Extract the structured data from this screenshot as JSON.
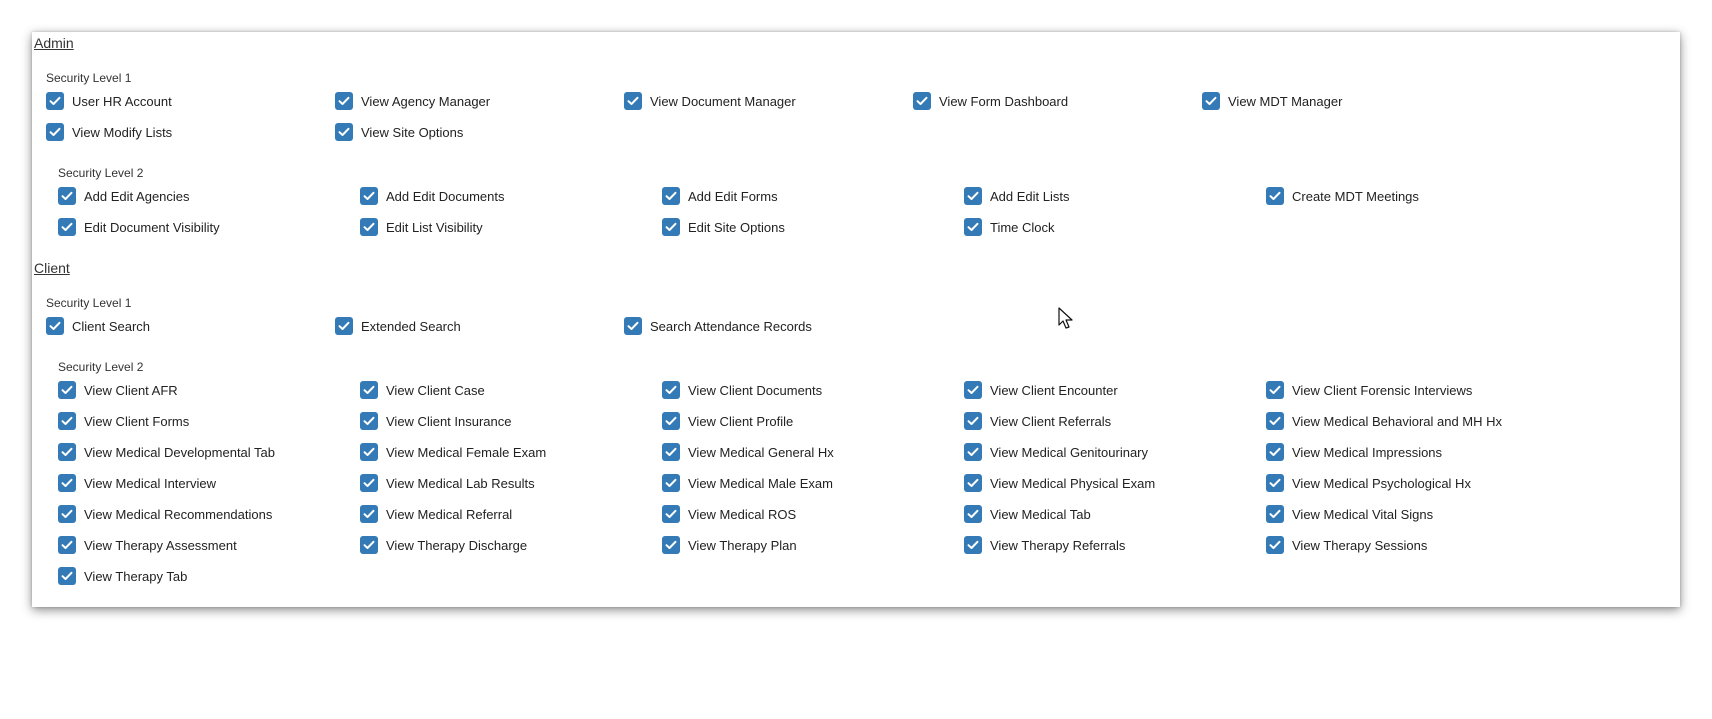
{
  "sections": [
    {
      "title": "Admin",
      "levels": [
        {
          "label": "Security Level 1",
          "items": [
            "User HR Account",
            "View Agency Manager",
            "View Document Manager",
            "View Form Dashboard",
            "View MDT Manager",
            "View Modify Lists",
            "View Site Options"
          ]
        },
        {
          "label": "Security Level 2",
          "items": [
            "Add Edit Agencies",
            "Add Edit Documents",
            "Add Edit Forms",
            "Add Edit Lists",
            "Create MDT Meetings",
            "Edit Document Visibility",
            "Edit List Visibility",
            "Edit Site Options",
            "Time Clock"
          ]
        }
      ]
    },
    {
      "title": "Client",
      "levels": [
        {
          "label": "Security Level 1",
          "items": [
            "Client Search",
            "Extended Search",
            "Search Attendance Records"
          ]
        },
        {
          "label": "Security Level 2",
          "items": [
            "View Client AFR",
            "View Client Case",
            "View Client Documents",
            "View Client Encounter",
            "View Client Forensic Interviews",
            "View Client Forms",
            "View Client Insurance",
            "View Client Profile",
            "View Client Referrals",
            "View Medical Behavioral and MH Hx",
            "View Medical Developmental Tab",
            "View Medical Female Exam",
            "View Medical General Hx",
            "View Medical Genitourinary",
            "View Medical Impressions",
            "View Medical Interview",
            "View Medical Lab Results",
            "View Medical Male Exam",
            "View Medical Physical Exam",
            "View Medical Psychological Hx",
            "View Medical Recommendations",
            "View Medical Referral",
            "View Medical ROS",
            "View Medical Tab",
            "View Medical Vital Signs",
            "View Therapy Assessment",
            "View Therapy Discharge",
            "View Therapy Plan",
            "View Therapy Referrals",
            "View Therapy Sessions",
            "View Therapy Tab"
          ]
        }
      ]
    }
  ],
  "checked": true,
  "colors": {
    "checkbox": "#337ab7"
  }
}
